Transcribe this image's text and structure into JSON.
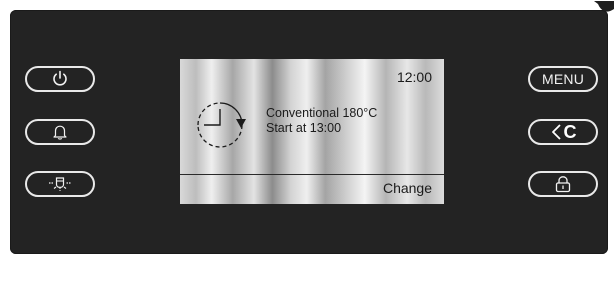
{
  "screen": {
    "time": "12:00",
    "program_line1": "Conventional 180°C",
    "program_line2": "Start at 13:00",
    "change_label": "Change"
  },
  "right_buttons": {
    "menu_label": "MENU",
    "back_label": "C"
  },
  "icons": {
    "power": "power-icon",
    "bell": "bell-icon",
    "light": "light-bulb-icon",
    "back": "chevron-left-icon",
    "lock": "lock-icon",
    "timer": "timer-icon"
  },
  "colors": {
    "panel": "#232323",
    "button_outline": "#e9e9e9",
    "screen_text": "#1b1b1b"
  }
}
